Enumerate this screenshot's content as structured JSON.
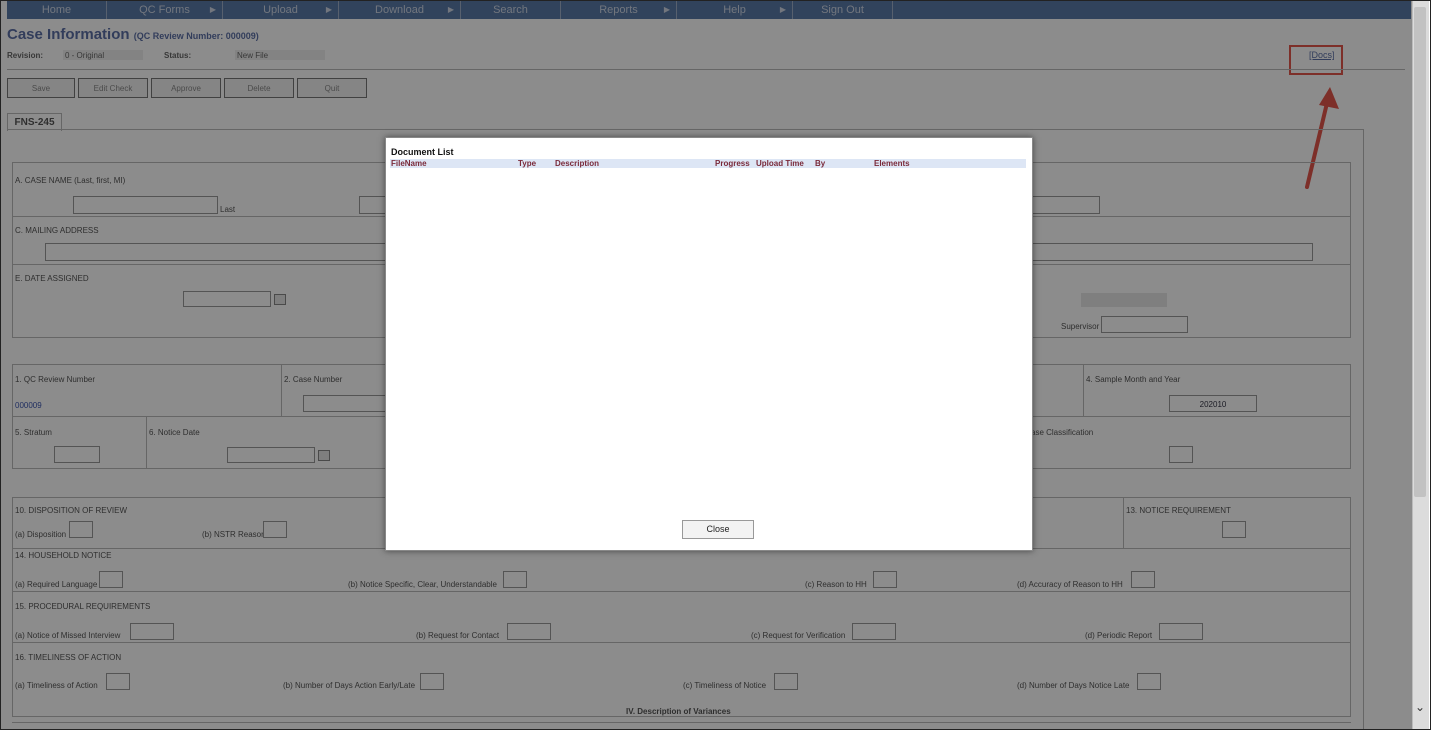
{
  "nav": {
    "items": [
      {
        "label": "Home",
        "has_arrow": false
      },
      {
        "label": "QC Forms",
        "has_arrow": true
      },
      {
        "label": "Upload",
        "has_arrow": true
      },
      {
        "label": "Download",
        "has_arrow": true
      },
      {
        "label": "Search",
        "has_arrow": false
      },
      {
        "label": "Reports",
        "has_arrow": true
      },
      {
        "label": "Help",
        "has_arrow": true
      },
      {
        "label": "Sign Out",
        "has_arrow": false
      }
    ]
  },
  "header": {
    "title": "Case Information",
    "subtitle": "(QC Review Number: 000009)",
    "revision_label": "Revision:",
    "revision_value": "0 - Original",
    "status_label": "Status:",
    "status_value": "New File",
    "docs_link": "[Docs]"
  },
  "toolbar": {
    "save": "Save",
    "edit_check": "Edit Check",
    "approve": "Approve",
    "delete": "Delete",
    "quit": "Quit"
  },
  "tab": {
    "label": "FNS-245"
  },
  "form": {
    "case_name_label": "A. CASE NAME (Last, first, MI)",
    "last_label": "Last",
    "mailing_label": "C. MAILING ADDRESS",
    "date_assigned_label": "E. DATE ASSIGNED",
    "supervisor_label": "Supervisor",
    "qc_review_label": "1. QC Review Number",
    "qc_review_value": "000009",
    "case_number_label": "2. Case Number",
    "sample_month_label": "4. Sample Month and Year",
    "sample_month_value": "202010",
    "stratum_label": "5. Stratum",
    "notice_date_label": "6. Notice Date",
    "case_class_label": "ase Classification",
    "disposition_label": "10. DISPOSITION OF REVIEW",
    "disposition_a": "(a) Disposition",
    "nstr_reason": "(b) NSTR Reason",
    "notice_req_label": "13. NOTICE REQUIREMENT",
    "hh_notice_label": "14. HOUSEHOLD NOTICE",
    "hh_a": "(a) Required Language",
    "hh_b": "(b) Notice Specific, Clear, Understandable",
    "hh_c": "(c) Reason to HH",
    "hh_d": "(d) Accuracy of Reason to HH",
    "proc_label": "15. PROCEDURAL REQUIREMENTS",
    "proc_a": "(a) Notice of Missed Interview",
    "proc_b": "(b) Request for Contact",
    "proc_c": "(c) Request for Verification",
    "proc_d": "(d) Periodic Report",
    "time_label": "16. TIMELINESS OF ACTION",
    "time_a": "(a) Timeliness of Action",
    "time_b": "(b) Number of Days Action Early/Late",
    "time_c": "(c) Timeliness of Notice",
    "time_d": "(d) Number of Days Notice Late",
    "variances_label": "IV. Description of Variances"
  },
  "modal": {
    "title": "Document List",
    "columns": [
      "FileName",
      "Type",
      "Description",
      "Progress",
      "Upload Time",
      "By",
      "Elements"
    ],
    "close": "Close"
  },
  "colors": {
    "nav_bg": "#5a7aa8",
    "title_color": "#5c6fa6",
    "highlight": "#e4574c",
    "header_text": "#7a2a3a"
  }
}
